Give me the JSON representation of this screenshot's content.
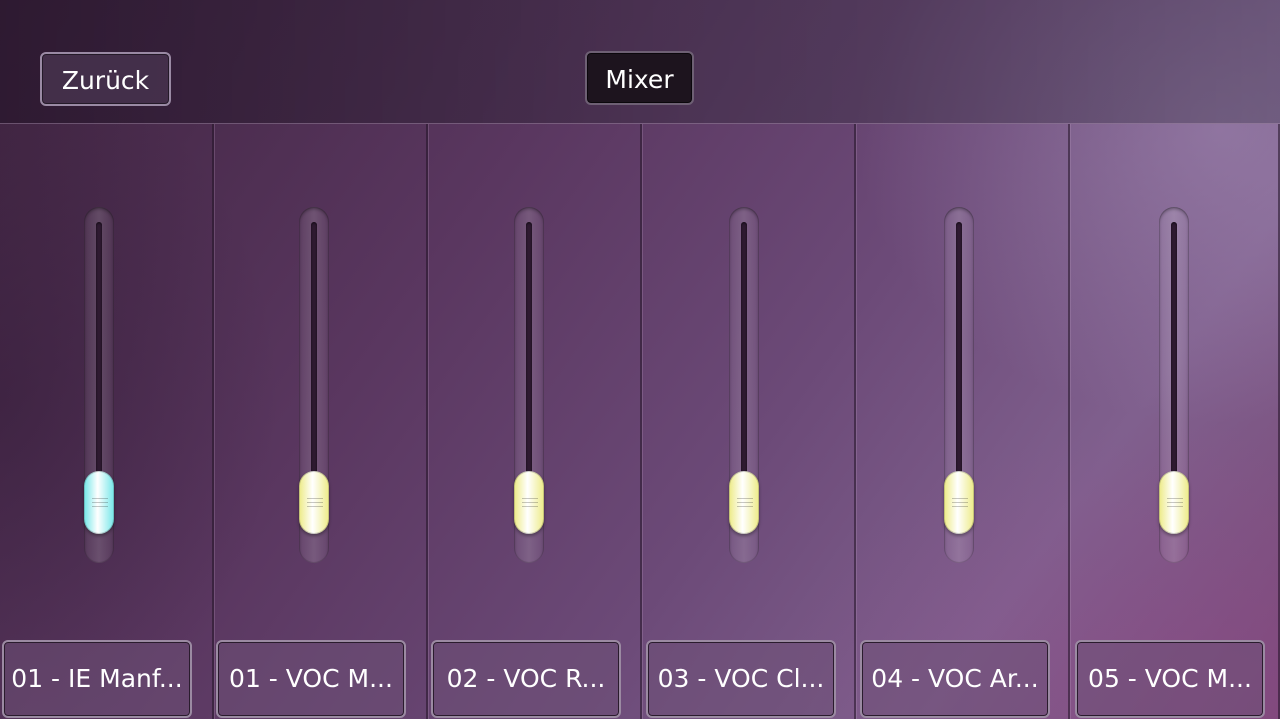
{
  "header": {
    "back_label": "Zurück",
    "mixer_label": "Mixer"
  },
  "colors": {
    "knob_selected": "#7de8ea",
    "knob_default": "#eeec8e"
  },
  "channels": [
    {
      "label": "01 - IE Manf...",
      "selected": true,
      "level": 0.1
    },
    {
      "label": "01 - VOC M...",
      "selected": false,
      "level": 0.1
    },
    {
      "label": "02 - VOC R...",
      "selected": false,
      "level": 0.1
    },
    {
      "label": "03 - VOC Cl...",
      "selected": false,
      "level": 0.1
    },
    {
      "label": "04 - VOC Ar...",
      "selected": false,
      "level": 0.1
    },
    {
      "label": "05 - VOC M...",
      "selected": false,
      "level": 0.1
    }
  ]
}
